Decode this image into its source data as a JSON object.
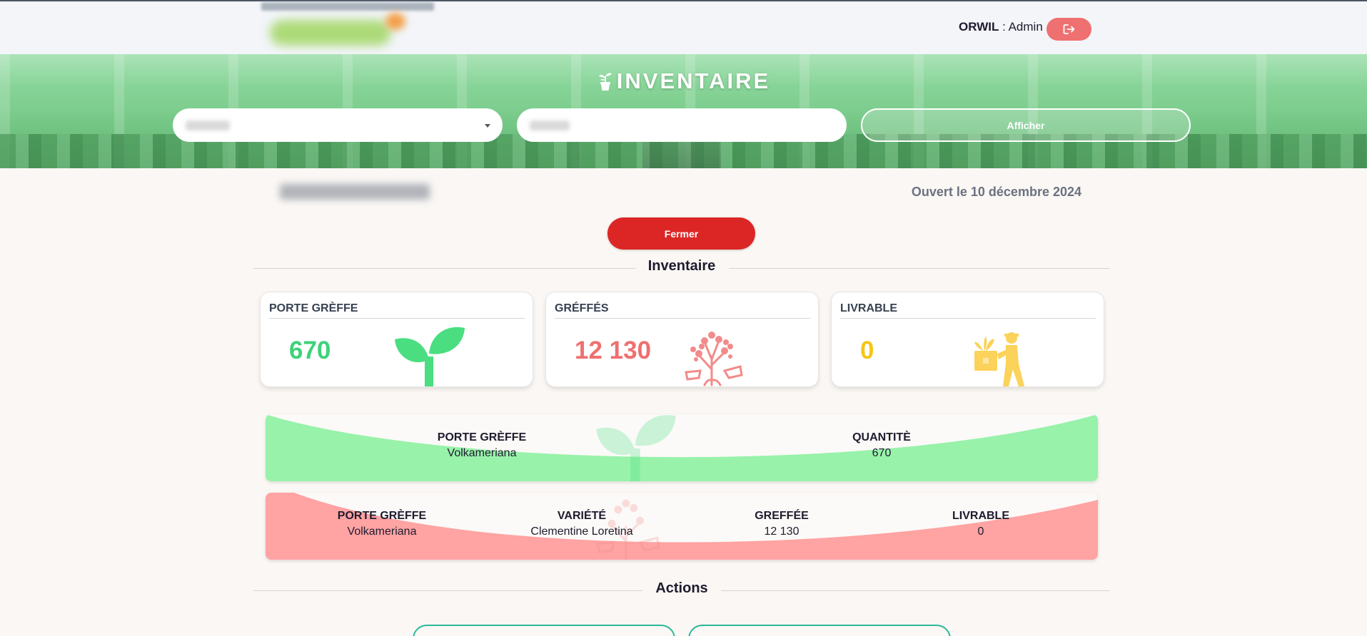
{
  "header": {
    "user_name": "ORWIL",
    "user_role": " : Admin",
    "icons": {
      "logout": "logout-icon",
      "logo": "garden-logo"
    }
  },
  "banner": {
    "title": "INVENTAIRE",
    "title_icon": "potted-plant-icon",
    "select_placeholder": "",
    "search_placeholder": "",
    "afficher_label": "Afficher"
  },
  "session": {
    "opened_label": "Ouvert le 10 décembre 2024",
    "close_label": "Fermer"
  },
  "inventory_section": {
    "title": "Inventaire"
  },
  "stats": [
    {
      "label": "PORTE GRÈFFE",
      "value": "670",
      "color": "#3ed27a",
      "icon": "sprout-icon"
    },
    {
      "label": "GRÉFFÉS",
      "value": "12 130",
      "color": "#ef6f6f",
      "icon": "grafted-tree-icon"
    },
    {
      "label": "LIVRABLE",
      "value": "0",
      "color": "#f5c518",
      "icon": "delivery-person-icon"
    }
  ],
  "rootstock_detail": {
    "columns": [
      {
        "header": "PORTE GRÈFFE",
        "value": "Volkameriana"
      },
      {
        "header": "QUANTITÈ",
        "value": "670"
      }
    ]
  },
  "grafted_detail": {
    "columns": [
      {
        "header": "PORTE GRÈFFE",
        "value": "Volkameriana"
      },
      {
        "header": "VARIÉTÉ",
        "value": "Clementine Loretina"
      },
      {
        "header": "GREFFÉE",
        "value": "12 130"
      },
      {
        "header": "LIVRABLE",
        "value": "0"
      }
    ]
  },
  "actions_section": {
    "title": "Actions"
  },
  "colors": {
    "green_band": "#98f2aa",
    "red_band": "#ffa3a3",
    "fermer": "#dc2626",
    "logout": "#ef7070",
    "action_border": "#2bb89a"
  }
}
